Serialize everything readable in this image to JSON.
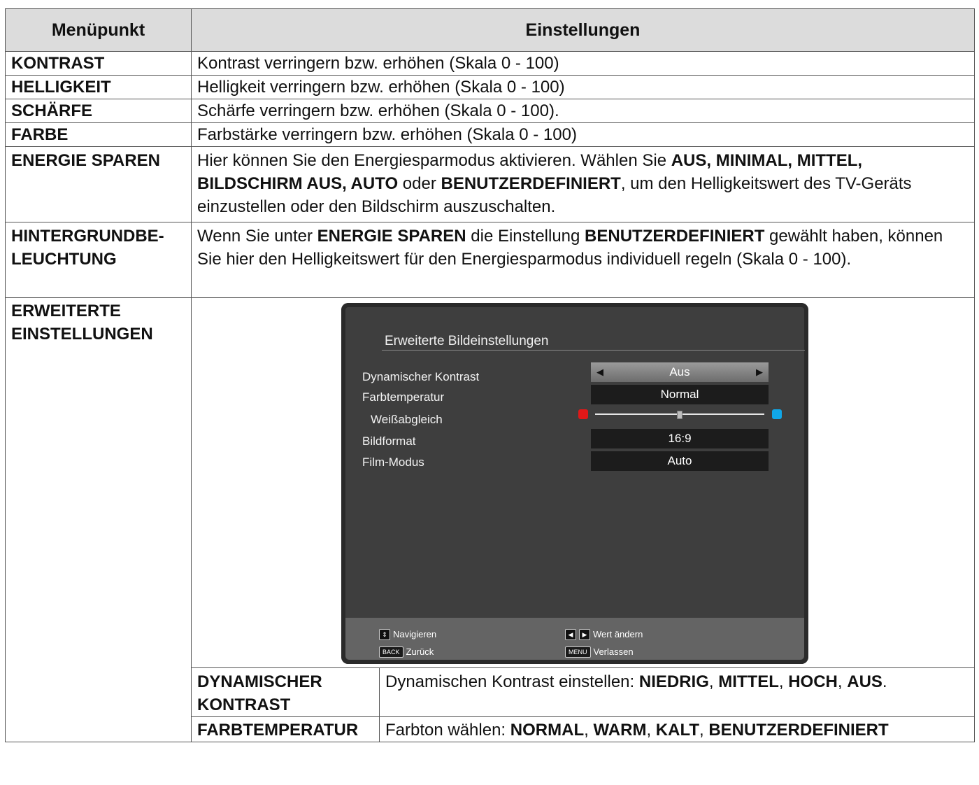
{
  "header": {
    "col1": "Menüpunkt",
    "col2": "Einstellungen"
  },
  "rows": [
    {
      "item": "KONTRAST",
      "desc": "Kontrast verringern bzw. erhöhen (Skala 0 - 100)"
    },
    {
      "item": "HELLIGKEIT",
      "desc": "Helligkeit verringern bzw. erhöhen (Skala 0 - 100)"
    },
    {
      "item": "SCHÄRFE",
      "desc": "Schärfe verringern bzw. erhöhen (Skala 0 - 100)."
    },
    {
      "item": "FARBE",
      "desc": "Farbstärke verringern bzw. erhöhen (Skala 0 - 100)"
    }
  ],
  "energy": {
    "item": "ENERGIE SPAREN",
    "t1": "Hier können Sie den Energiesparmodus aktivieren. Wählen Sie ",
    "b1": "AUS, MINIMAL, MITTEL, BILDSCHIRM AUS, AUTO",
    "t2": " oder ",
    "b2": "BENUTZERDEFINIERT",
    "t3": ", um den Helligkeitswert des TV-Geräts einzustellen oder den Bildschirm auszuschalten."
  },
  "backlight": {
    "item_line1": "HINTERGRUNDBE-",
    "item_line2": "LEUCHTUNG",
    "t1": "Wenn Sie unter ",
    "b1": "ENERGIE SPAREN",
    "t2": " die Einstellung ",
    "b2": "BENUTZERDEFINIERT",
    "t3": " gewählt haben, können Sie hier den Helligkeitswert für den Energiesparmodus individuell regeln (Skala 0 - 100)."
  },
  "advanced": {
    "item_line1": "ERWEITERTE",
    "item_line2": "EINSTELLUNGEN"
  },
  "tv": {
    "title": "Erweiterte Bildeinstellungen",
    "dyn_label": "Dynamischer Kontrast",
    "dyn_value": "Aus",
    "temp_label": "Farbtemperatur",
    "temp_value": "Normal",
    "wb_label": "Weißabgleich",
    "format_label": "Bildformat",
    "format_value": "16:9",
    "film_label": "Film-Modus",
    "film_value": "Auto",
    "wb_level": 0.5,
    "footer": {
      "nav": "Navigieren",
      "change": "Wert ändern",
      "back_key": "BACK",
      "back": "Zurück",
      "menu_key": "MENU",
      "exit": "Verlassen"
    }
  },
  "sub": [
    {
      "item_line1": "DYNAMISCHER",
      "item_line2": "KONTRAST",
      "t1": "Dynamischen Kontrast einstellen: ",
      "b1": "NIEDRIG",
      "s1": ", ",
      "b2": "MITTEL",
      "s2": ", ",
      "b3": "HOCH",
      "s3": ", ",
      "b4": "AUS",
      "s4": "."
    },
    {
      "item": "FARBTEMPERATUR",
      "t1": "Farbton wählen: ",
      "b1": "NORMAL",
      "s1": ", ",
      "b2": "WARM",
      "s2": ", ",
      "b3": "KALT",
      "s3": ", ",
      "b4": "BENUTZERDEFINIERT"
    }
  ]
}
